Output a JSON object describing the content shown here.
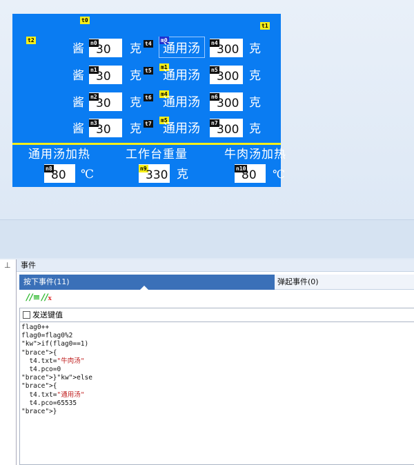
{
  "canvas": {
    "labels": {
      "t0": "t0",
      "t1": "t1",
      "t2": "t2"
    },
    "rows": [
      {
        "sauce": "酱",
        "sauce_tag": "n0",
        "sauce_val": "30",
        "unit1": "克",
        "t_tag": "t4",
        "soup_tag": "m0",
        "soup": "通用汤",
        "n_tag": "n4",
        "n_val": "300",
        "unit2": "克"
      },
      {
        "sauce": "酱",
        "sauce_tag": "n1",
        "sauce_val": "30",
        "unit1": "克",
        "t_tag": "t5",
        "soup_tag": "m1",
        "soup": "通用汤",
        "n_tag": "n5",
        "n_val": "300",
        "unit2": "克"
      },
      {
        "sauce": "酱",
        "sauce_tag": "n2",
        "sauce_val": "30",
        "unit1": "克",
        "t_tag": "t6",
        "soup_tag": "m4",
        "soup": "通用汤",
        "n_tag": "n6",
        "n_val": "300",
        "unit2": "克"
      },
      {
        "sauce": "酱",
        "sauce_tag": "n3",
        "sauce_val": "30",
        "unit1": "克",
        "t_tag": "t7",
        "soup_tag": "m5",
        "soup": "通用汤",
        "n_tag": "n7",
        "n_val": "300",
        "unit2": "克"
      }
    ],
    "bottom": {
      "heat_general_label": "通用汤加热",
      "scale_label": "工作台重量",
      "heat_beef_label": "牛肉汤加热",
      "n8_tag": "n8",
      "n8_val": "80",
      "n8_unit": "℃",
      "n9_tag": "n9",
      "n9_val": "330",
      "n9_unit": "克",
      "n10_tag": "n10",
      "n10_val": "80",
      "n10_unit": "℃"
    }
  },
  "panel": {
    "pin_icon": "pin-icon",
    "title": "事件",
    "tab_press": "按下事件(11)",
    "tab_release": "弹起事件(0)",
    "tool_comment": "//≡",
    "tool_uncomment": "//",
    "send_key_label": "发送键值",
    "code_lines": [
      "flag0++",
      "flag0=flag0%2",
      "if(flag0==1)",
      "{",
      "  t4.txt=\"牛肉汤\"",
      "  t4.pco=0",
      "}else",
      "{",
      "  t4.txt=\"通用汤\"",
      "  t4.pco=65535",
      "}"
    ]
  },
  "colors": {
    "hmi_bg": "#0a7cf2",
    "divider": "#f7ef18",
    "tab_active": "#3a70b8"
  }
}
